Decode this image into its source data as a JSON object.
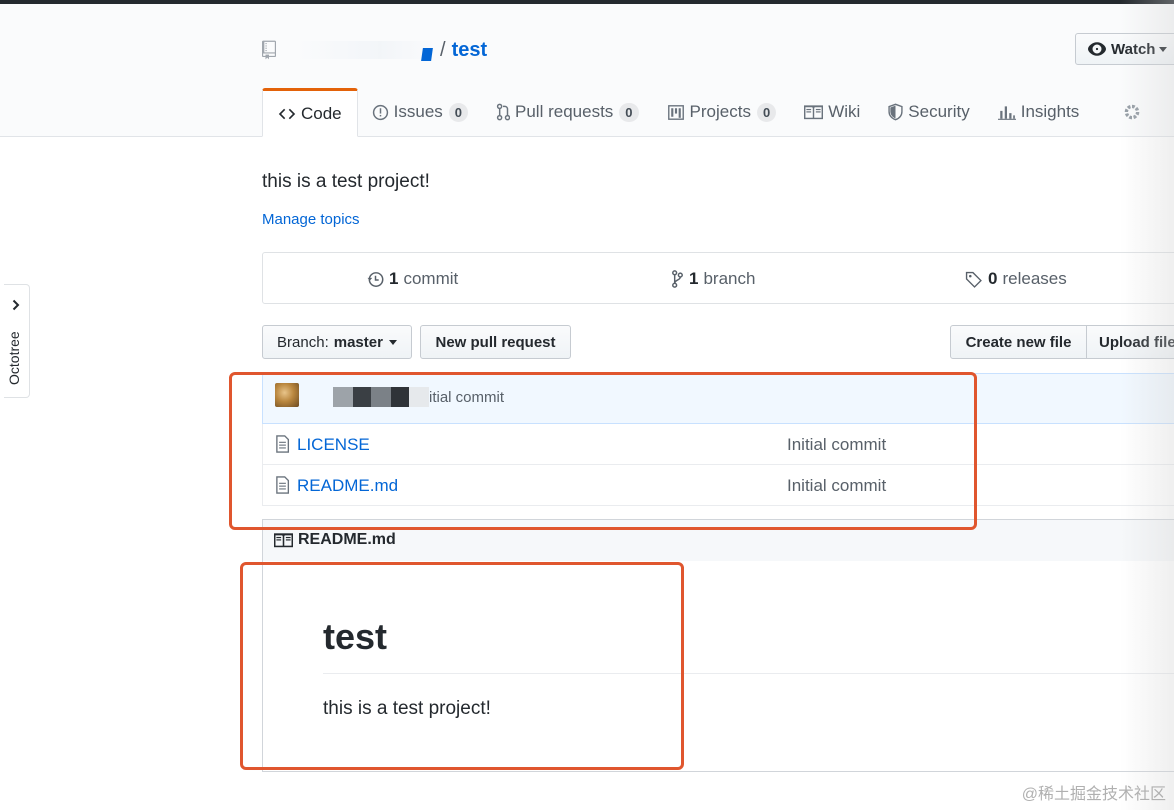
{
  "repo": {
    "name": "test",
    "separator": "/"
  },
  "header": {
    "watch_label": "Watch"
  },
  "tabs": [
    {
      "label": "Code"
    },
    {
      "label": "Issues",
      "count": "0"
    },
    {
      "label": "Pull requests",
      "count": "0"
    },
    {
      "label": "Projects",
      "count": "0"
    },
    {
      "label": "Wiki"
    },
    {
      "label": "Security"
    },
    {
      "label": "Insights"
    }
  ],
  "description": "this is a test project!",
  "manage_topics": "Manage topics",
  "summary": {
    "commits": {
      "count": "1",
      "label": "commit"
    },
    "branches": {
      "count": "1",
      "label": "branch"
    },
    "releases": {
      "count": "0",
      "label": "releases"
    }
  },
  "toolbar": {
    "branch_label": "Branch:",
    "branch_value": "master",
    "new_pr": "New pull request",
    "create_file": "Create new file",
    "upload_files": "Upload file"
  },
  "latest_commit": {
    "message": "itial commit"
  },
  "files": [
    {
      "name": "LICENSE",
      "message": "Initial commit"
    },
    {
      "name": "README.md",
      "message": "Initial commit"
    }
  ],
  "readme": {
    "file_name": "README.md",
    "heading": "test",
    "paragraph": "this is a test project!"
  },
  "octotree": {
    "label": "Octotree"
  },
  "watermark": "@稀土掘金技术社区",
  "colors": {
    "link": "#0366d6",
    "highlight": "#e0562e",
    "tab_accent": "#e36209"
  }
}
